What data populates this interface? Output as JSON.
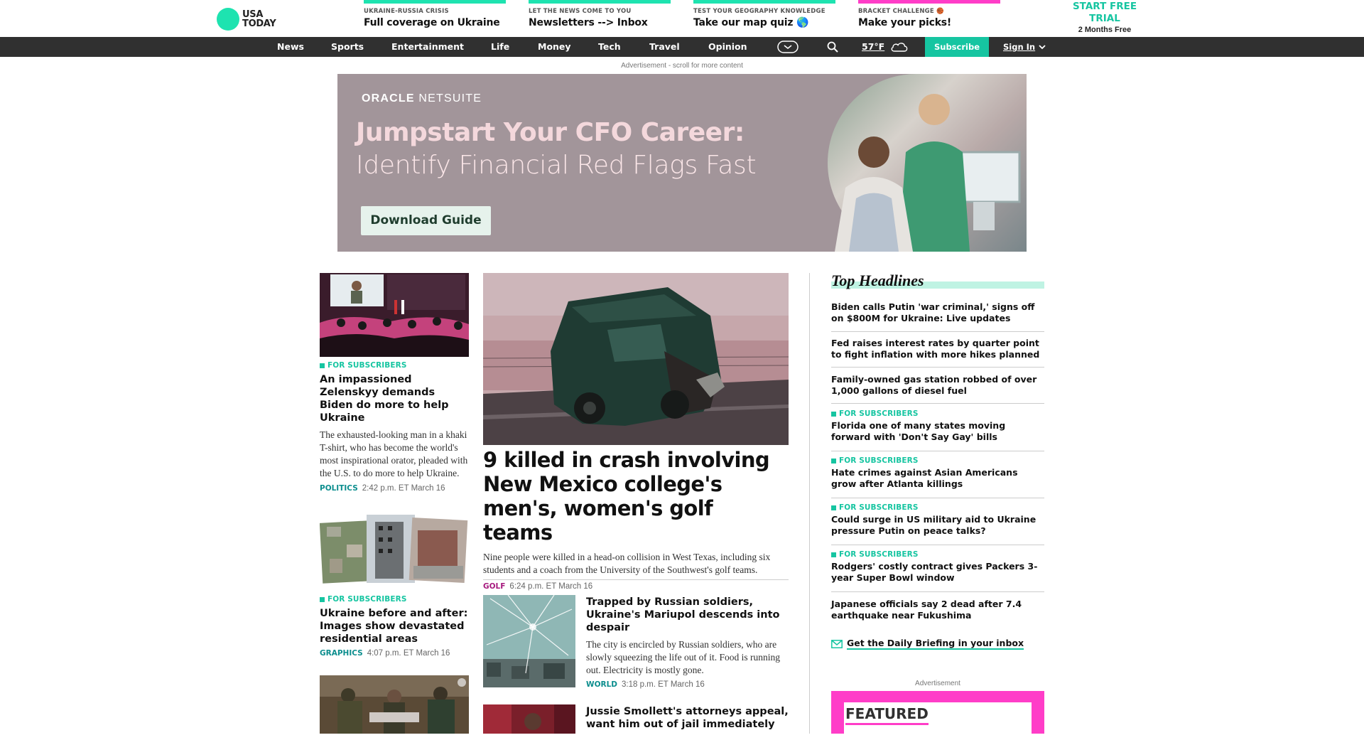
{
  "logo": {
    "line1": "USA",
    "line2": "TODAY"
  },
  "promos": [
    {
      "kicker": "UKRAINE-RUSSIA CRISIS",
      "headline": "Full coverage on Ukraine",
      "color": "#1ee3b0"
    },
    {
      "kicker": "LET THE NEWS COME TO YOU",
      "headline": "Newsletters --> Inbox",
      "color": "#1ee3b0"
    },
    {
      "kicker": "TEST YOUR GEOGRAPHY KNOWLEDGE",
      "headline": "Take our map quiz 🌎",
      "color": "#1ee3b0"
    },
    {
      "kicker": "BRACKET CHALLENGE 🏀",
      "headline": "Make your picks!",
      "color": "#ff3dc8"
    }
  ],
  "trial": {
    "line1": "START FREE",
    "line2": "TRIAL",
    "sub": "2 Months Free"
  },
  "nav": {
    "items": [
      "News",
      "Sports",
      "Entertainment",
      "Life",
      "Money",
      "Tech",
      "Travel",
      "Opinion"
    ],
    "weather": "57°F",
    "subscribe": "Subscribe",
    "signin": "Sign In"
  },
  "ad": {
    "label": "Advertisement - scroll for more content",
    "brand_bold": "ORACLE",
    "brand_light": " NETSUITE",
    "headline1": "Jumpstart Your CFO Career:",
    "headline2": "Identify Financial Red Flags Fast",
    "button": "Download Guide"
  },
  "left_stories": [
    {
      "label": "FOR SUBSCRIBERS",
      "headline": "An impassioned Zelenskyy demands Biden do more to help Ukraine",
      "summary": "The exhausted-looking man in a khaki T-shirt, who has become the world's most inspirational orator, pleaded with the U.S. to do more to help Ukraine.",
      "tag": "POLITICS",
      "time": "2:42 p.m. ET March 16"
    },
    {
      "label": "FOR SUBSCRIBERS",
      "headline": "Ukraine before and after: Images show devastated residential areas",
      "tag": "GRAPHICS",
      "time": "4:07 p.m. ET March 16"
    }
  ],
  "lead_story": {
    "headline": "9 killed in crash involving New Mexico college's men's, women's golf teams",
    "summary": "Nine people were killed in a head-on collision in West Texas, including six students and a coach from the University of the Southwest's golf teams.",
    "tag": "GOLF",
    "time": "6:24 p.m. ET March 16"
  },
  "mid_stories": [
    {
      "headline": "Trapped by Russian soldiers, Ukraine's Mariupol descends into despair",
      "summary": "The city is encircled by Russian soldiers, who are slowly squeezing the life out of it. Food is running out. Electricity is mostly gone.",
      "tag": "WORLD",
      "time": "3:18 p.m. ET March 16"
    },
    {
      "headline": "Jussie Smollett's attorneys appeal, want him out of jail immediately"
    }
  ],
  "top_headlines": {
    "title": "Top Headlines",
    "items": [
      {
        "label": "",
        "headline": "Biden calls Putin 'war criminal,' signs off on $800M for Ukraine: Live updates"
      },
      {
        "label": "",
        "headline": "Fed raises interest rates by quarter point to fight inflation with more hikes planned"
      },
      {
        "label": "",
        "headline": "Family-owned gas station robbed of over 1,000 gallons of diesel fuel"
      },
      {
        "label": "FOR SUBSCRIBERS",
        "headline": "Florida one of many states moving forward with 'Don't Say Gay' bills"
      },
      {
        "label": "FOR SUBSCRIBERS",
        "headline": "Hate crimes against Asian Americans grow after Atlanta killings"
      },
      {
        "label": "FOR SUBSCRIBERS",
        "headline": "Could surge in US military aid to Ukraine pressure Putin on peace talks?"
      },
      {
        "label": "FOR SUBSCRIBERS",
        "headline": "Rodgers' costly contract gives Packers 3-year Super Bowl window"
      },
      {
        "label": "",
        "headline": "Japanese officials say 2 dead after 7.4 earthquake near Fukushima"
      }
    ]
  },
  "briefing": "Get the Daily Briefing in your inbox",
  "ad2_label": "Advertisement",
  "featured": "FEATURED",
  "colors": {
    "accent": "#16c5a1",
    "nav_bg": "#303030",
    "pink": "#ff3dc8",
    "golf_tag": "#a6197e",
    "tag_teal": "#0c8e8e"
  }
}
